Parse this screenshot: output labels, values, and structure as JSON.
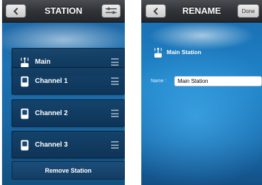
{
  "station_screen": {
    "title": "STATION",
    "items": [
      {
        "label": "Main",
        "icon": "antenna-icon"
      },
      {
        "label": "Channel 1",
        "icon": "device-icon"
      },
      {
        "label": "Channel 2",
        "icon": "device-icon"
      },
      {
        "label": "Channel 3",
        "icon": "device-icon"
      }
    ],
    "remove_label": "Remove Station"
  },
  "rename_screen": {
    "title": "RENAME",
    "done_label": "Done",
    "station_label": "Main Station",
    "name_label": "Name :",
    "name_value": "Main Station"
  }
}
